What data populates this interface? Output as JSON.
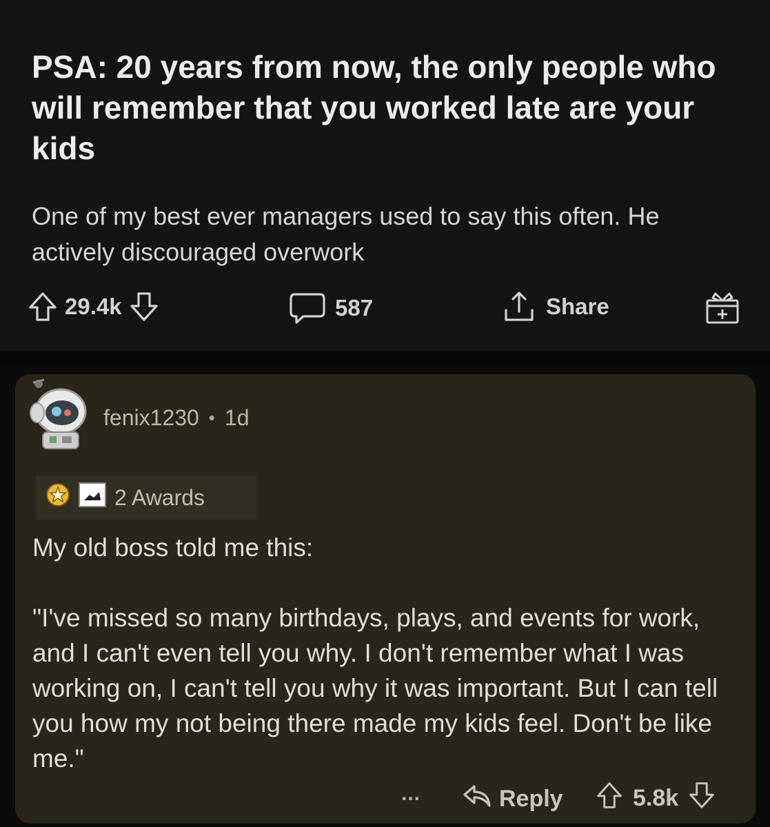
{
  "post": {
    "title": "PSA: 20 years from now, the only people who will remember that you worked late are your kids",
    "body": "One of my best ever managers used to say this often. He actively discouraged overwork",
    "upvotes": "29.4k",
    "comments": "587",
    "share_label": "Share"
  },
  "comment": {
    "author": "fenix1230",
    "separator": "•",
    "age": "1d",
    "awards_label": "2 Awards",
    "paragraphs": [
      "My old boss told me this:",
      "\"I've missed so many birthdays, plays, and events for work, and I can't even tell you why.  I don't remember what I was working on, I can't tell you why it was important.  But I can tell you how my not being there made my kids feel.  Don't be like me.\""
    ],
    "more_label": "...",
    "reply_label": "Reply",
    "votes": "5.8k"
  },
  "colors": {
    "background": "#0b0b0b",
    "post_bg": "#141414",
    "comment_bg": "#2a2519",
    "text": "#e6e6e6"
  },
  "icons": [
    "upvote-icon",
    "downvote-icon",
    "comment-icon",
    "share-icon",
    "award-icon",
    "avatar",
    "award-star-icon",
    "award-image-icon",
    "reply-icon"
  ]
}
